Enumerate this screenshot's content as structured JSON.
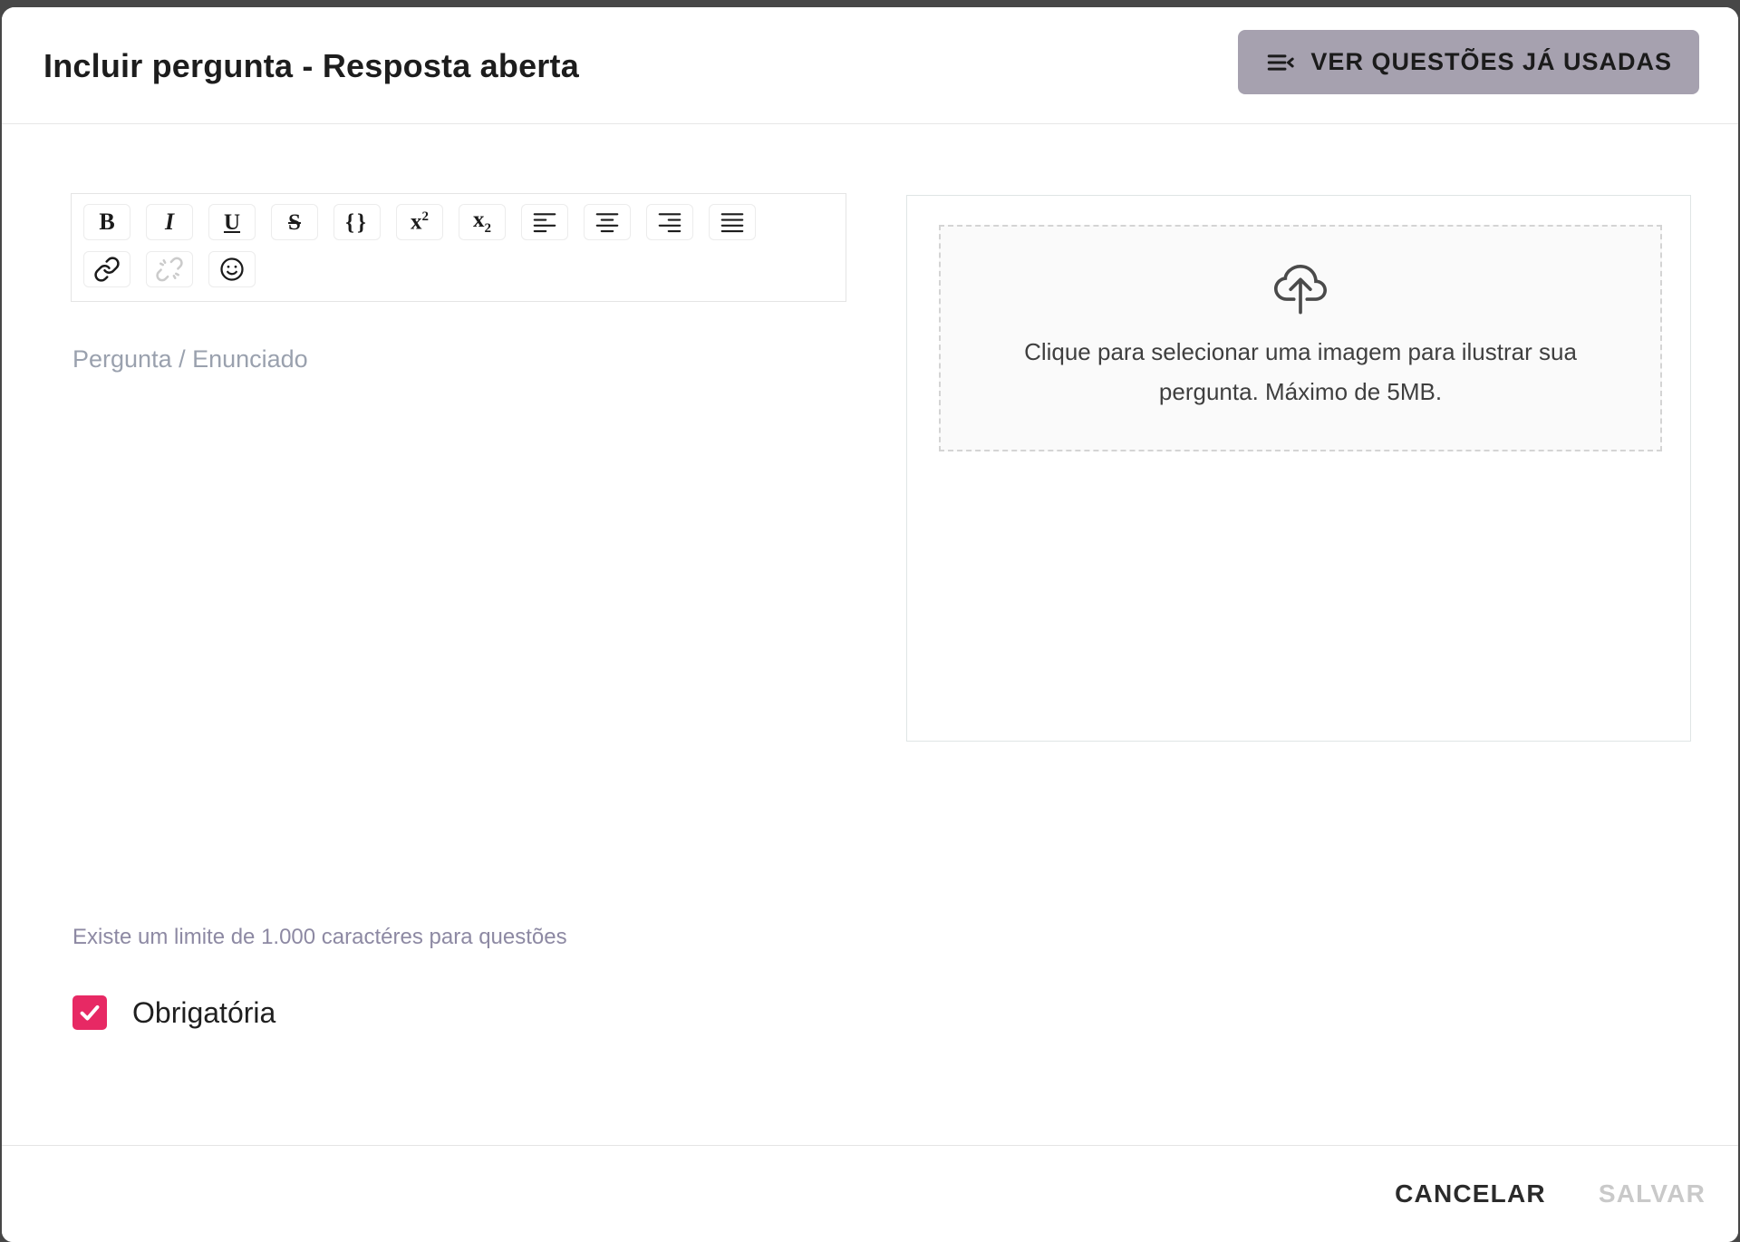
{
  "colors": {
    "accent-pink": "#e72964",
    "header-button-bg": "#a6a1af",
    "backdrop": "#474747",
    "muted-label": "#9aa1ae",
    "helper-purple": "#8d89a3",
    "disabled-text": "#c9c9c9"
  },
  "header": {
    "title": "Incluir pergunta - Resposta aberta",
    "used_questions_button": {
      "label": "VER QUESTÕES JÁ USADAS",
      "icon": "menu-open-icon"
    }
  },
  "editor": {
    "placeholder": "Pergunta / Enunciado",
    "toolbar_row1": [
      {
        "name": "bold",
        "glyph": "B"
      },
      {
        "name": "italic",
        "glyph": "I"
      },
      {
        "name": "underline",
        "glyph": "U"
      },
      {
        "name": "strikethrough",
        "glyph": "S"
      },
      {
        "name": "code-braces",
        "glyph": "{}"
      },
      {
        "name": "superscript",
        "base": "x",
        "script": "2"
      },
      {
        "name": "subscript",
        "base": "x",
        "script": "2"
      },
      {
        "name": "align-left"
      },
      {
        "name": "align-center"
      },
      {
        "name": "align-right"
      },
      {
        "name": "align-justify"
      }
    ],
    "toolbar_row2": [
      {
        "name": "link"
      },
      {
        "name": "unlink",
        "disabled": true
      },
      {
        "name": "emoji"
      }
    ]
  },
  "upload": {
    "icon": "cloud-upload-icon",
    "instruction": "Clique para selecionar uma imagem para ilustrar sua pergunta. Máximo de 5MB."
  },
  "question_limit_note": "Existe um limite de 1.000 caractéres para questões",
  "required_checkbox": {
    "label": "Obrigatória",
    "checked": true
  },
  "footer": {
    "cancel_label": "CANCELAR",
    "save_label": "SALVAR",
    "save_disabled": true
  }
}
